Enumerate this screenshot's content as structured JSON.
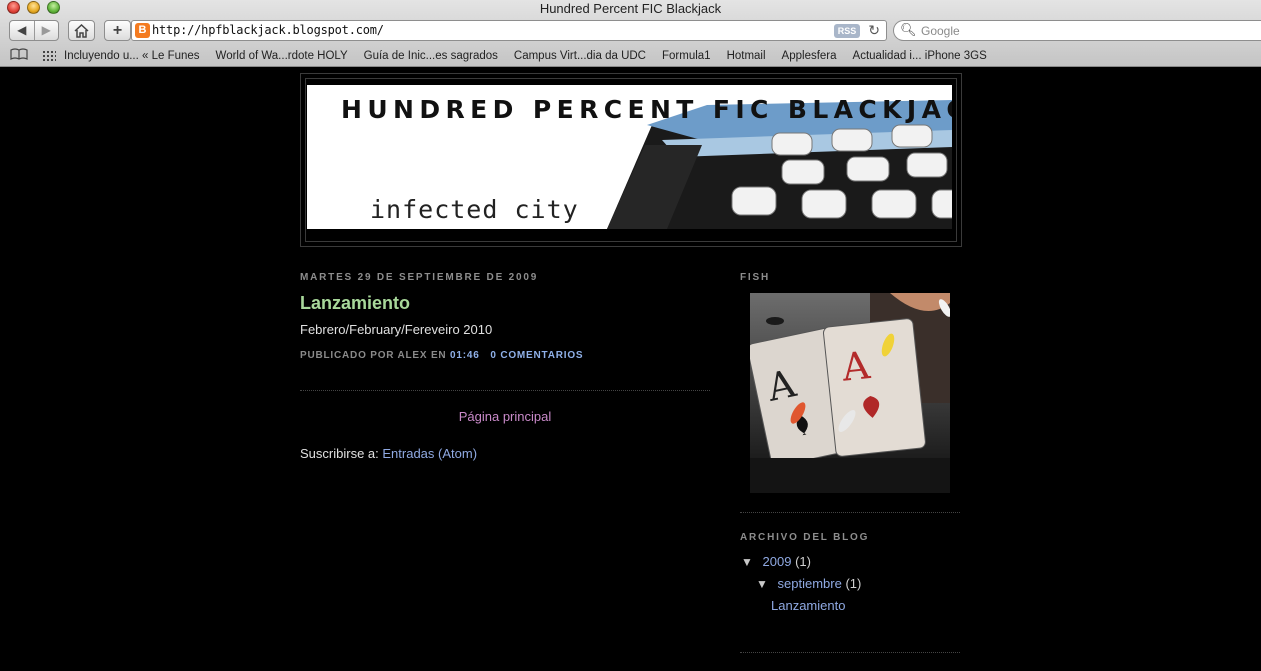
{
  "browser": {
    "window_title": "Hundred Percent FIC Blackjack",
    "url": "http://hpfblackjack.blogspot.com/",
    "rss_label": "RSS",
    "search_placeholder": "Google",
    "bookmarks": [
      "Incluyendo u... « Le Funes",
      "World of Wa...rdote HOLY",
      "Guía de Inic...es sagrados",
      "Campus Virt...dia da UDC",
      "Formula1",
      "Hotmail",
      "Applesfera",
      "Actualidad i... iPhone 3GS"
    ],
    "favicon_letter": "B",
    "icons": {
      "back": "back-arrow-icon",
      "forward": "forward-arrow-icon",
      "home": "home-icon",
      "add": "plus-icon",
      "reload": "reload-icon",
      "search": "magnifier-icon",
      "reading_list": "book-icon",
      "top_sites": "grid-icon"
    }
  },
  "blog": {
    "header_title": "HUNDRED PERCENT FIC BLACKJACK",
    "header_subtitle": "infected city",
    "post": {
      "date": "MARTES 29 DE SEPTIEMBRE DE 2009",
      "title": "Lanzamiento",
      "body": "Febrero/February/Fereveiro 2010",
      "footer_prefix": "PUBLICADO POR ALEX EN",
      "time": "01:46",
      "comments": "0 COMENTARIOS"
    },
    "home_link": "Página principal",
    "subscribe_label": "Suscribirse a:",
    "subscribe_link": "Entradas (Atom)",
    "sidebar": {
      "fish_heading": "FISH",
      "archive_heading": "ARCHIVO DEL BLOG",
      "archive": {
        "year": "2009",
        "year_count": "(1)",
        "month": "septiembre",
        "month_count": "(1)",
        "post": "Lanzamiento"
      }
    }
  },
  "colors": {
    "page_bg": "#000000",
    "post_title": "#a8d89a",
    "link": "#8fa9e2",
    "home_link": "#c98ac9",
    "muted": "#8d8d8d"
  }
}
